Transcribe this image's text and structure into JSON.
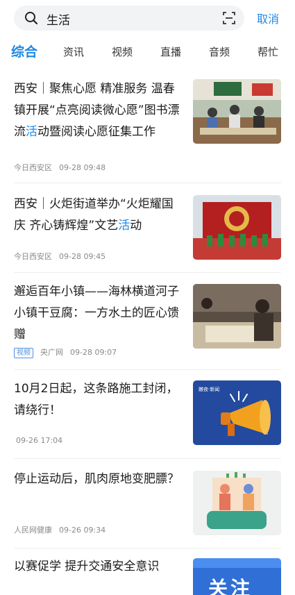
{
  "search": {
    "query": "生活",
    "cancel_label": "取消"
  },
  "tabs": [
    "综合",
    "资讯",
    "视频",
    "直播",
    "音频",
    "帮忙"
  ],
  "items": [
    {
      "title_before": "西安｜聚焦心愿 精准服务 温春镇开展“点亮阅读微心愿”图书漂流",
      "title_highlight": "活",
      "title_after": "动暨阅读心愿征集工作",
      "source": "今日西安区",
      "time": "09-28 09:48"
    },
    {
      "title_before": "西安｜火炬街道举办“火炬耀国庆 齐心铸辉煌”文艺",
      "title_highlight": "活",
      "title_after": "动",
      "source": "今日西安区",
      "time": "09-28 09:45"
    },
    {
      "title_before": "邂逅百年小镇——海林横道河子小镇干豆腐：一方水土的匠心馈赠",
      "title_highlight": "",
      "title_after": "",
      "badge": "视频",
      "source": "央广网",
      "time": "09-28 09:07"
    },
    {
      "title_before": "10月2日起，这条路施工封闭，请绕行！",
      "title_highlight": "",
      "title_after": "",
      "source": "",
      "time": "09-26 17:04",
      "thumb_caption": "嫩夜·新闻"
    },
    {
      "title_before": "停止运动后，肌肉原地变肥膘？",
      "title_highlight": "",
      "title_after": "",
      "source": "人民网健康",
      "time": "09-26 09:34"
    },
    {
      "title_before": "以赛促学 提升交通安全意识",
      "title_highlight": "",
      "title_after": "",
      "source": "",
      "time": "",
      "thumb_caption": "关注"
    }
  ],
  "colors": {
    "accent": "#1e88e5",
    "meta": "#8a8a8a",
    "search_bg": "#f2f3f5"
  },
  "icons": [
    "search-icon",
    "scan-icon"
  ]
}
